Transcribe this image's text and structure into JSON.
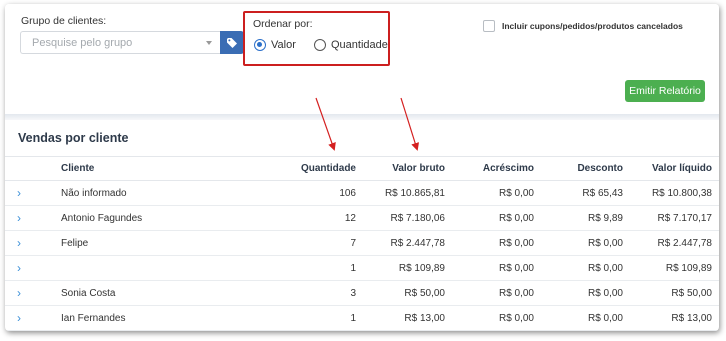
{
  "filters": {
    "group_label": "Grupo de clientes:",
    "group_placeholder": "Pesquise pelo grupo",
    "order_label": "Ordenar por:",
    "order_options": [
      "Valor",
      "Quantidade"
    ],
    "order_selected": "Valor",
    "include_cancelled_label": "Incluir cupons/pedidos/produtos cancelados",
    "emit_button": "Emitir Relatório"
  },
  "section": {
    "title": "Vendas por cliente"
  },
  "table": {
    "headers": [
      "",
      "Cliente",
      "Quantidade",
      "Valor bruto",
      "Acréscimo",
      "Desconto",
      "Valor líquido"
    ],
    "rows": [
      {
        "cliente": "Não informado",
        "quantidade": "106",
        "valor_bruto": "R$ 10.865,81",
        "acrescimo": "R$ 0,00",
        "desconto": "R$ 65,43",
        "valor_liquido": "R$ 10.800,38"
      },
      {
        "cliente": "Antonio Fagundes",
        "quantidade": "12",
        "valor_bruto": "R$ 7.180,06",
        "acrescimo": "R$ 0,00",
        "desconto": "R$ 9,89",
        "valor_liquido": "R$ 7.170,17"
      },
      {
        "cliente": "Felipe",
        "quantidade": "7",
        "valor_bruto": "R$ 2.447,78",
        "acrescimo": "R$ 0,00",
        "desconto": "R$ 0,00",
        "valor_liquido": "R$ 2.447,78"
      },
      {
        "cliente": "",
        "quantidade": "1",
        "valor_bruto": "R$ 109,89",
        "acrescimo": "R$ 0,00",
        "desconto": "R$ 0,00",
        "valor_liquido": "R$ 109,89"
      },
      {
        "cliente": "Sonia Costa",
        "quantidade": "3",
        "valor_bruto": "R$ 50,00",
        "acrescimo": "R$ 0,00",
        "desconto": "R$ 0,00",
        "valor_liquido": "R$ 50,00"
      },
      {
        "cliente": "Ian Fernandes",
        "quantidade": "1",
        "valor_bruto": "R$ 13,00",
        "acrescimo": "R$ 0,00",
        "desconto": "R$ 0,00",
        "valor_liquido": "R$ 13,00"
      }
    ]
  },
  "colors": {
    "highlight_border": "#cc1f1f",
    "annotation_arrows": "#d42020",
    "primary_blue": "#3a6db4",
    "emit_green": "#4caf50",
    "expand_chevron": "#3a8fd8"
  },
  "icons": {
    "group_button": "tag-icon",
    "row_expand": "chevron-right-icon",
    "select_caret": "caret-down-icon"
  }
}
